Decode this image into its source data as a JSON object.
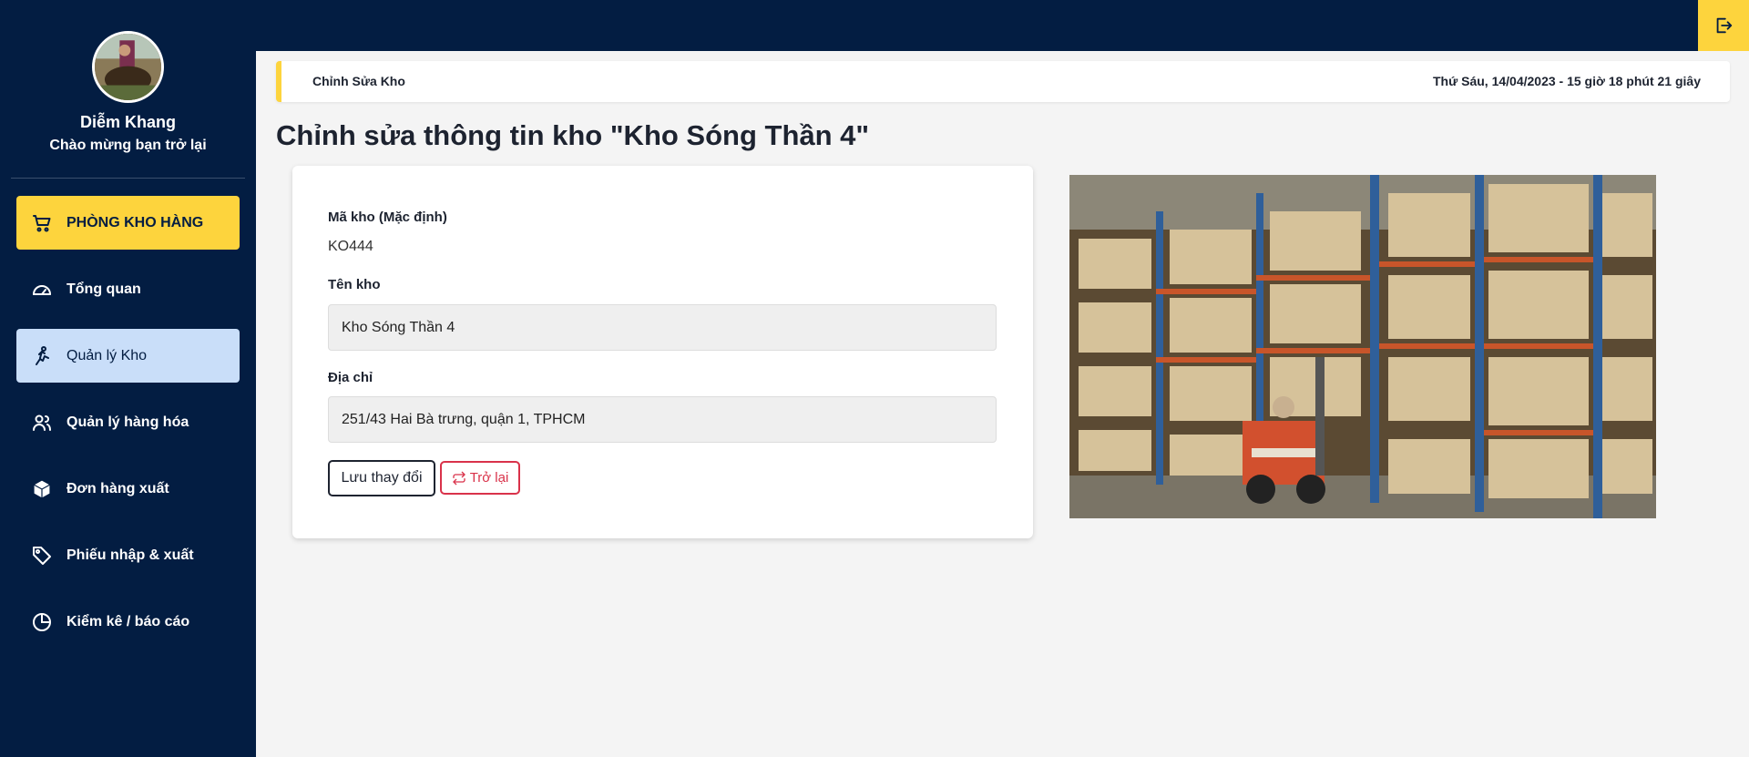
{
  "user": {
    "name": "Diễm Khang",
    "welcome": "Chào mừng bạn trở lại"
  },
  "sidebar": {
    "store_label": "PHÒNG KHO HÀNG",
    "items": [
      {
        "label": "Tổng quan",
        "icon": "gauge-icon"
      },
      {
        "label": "Quản lý Kho",
        "icon": "running-person-icon",
        "active": true
      },
      {
        "label": "Quản lý hàng hóa",
        "icon": "users-icon"
      },
      {
        "label": "Đơn hàng xuất",
        "icon": "box-icon"
      },
      {
        "label": "Phiếu nhập & xuất",
        "icon": "tag-icon"
      },
      {
        "label": "Kiểm kê / báo cáo",
        "icon": "pie-chart-icon"
      }
    ]
  },
  "topbar": {
    "logout_icon": "logout-icon"
  },
  "breadcrumb": {
    "label": "Chỉnh Sửa Kho",
    "datetime": "Thứ Sáu, 14/04/2023 - 15 giờ 18 phút 21 giây"
  },
  "page": {
    "title": "Chỉnh sửa thông tin kho \"Kho Sóng Thần 4\""
  },
  "form": {
    "code_label": "Mã kho (Mặc định)",
    "code_value": "KO444",
    "name_label": "Tên kho",
    "name_value": "Kho Sóng Thần 4",
    "address_label": "Địa chỉ",
    "address_value": "251/43 Hai Bà trưng, quận 1, TPHCM",
    "save_label": "Lưu thay đổi",
    "back_label": "Trở lại"
  },
  "colors": {
    "sidebar_bg": "#031d42",
    "accent_yellow": "#fdd43d",
    "active_bg": "#c9def9",
    "danger": "#d9324a"
  }
}
